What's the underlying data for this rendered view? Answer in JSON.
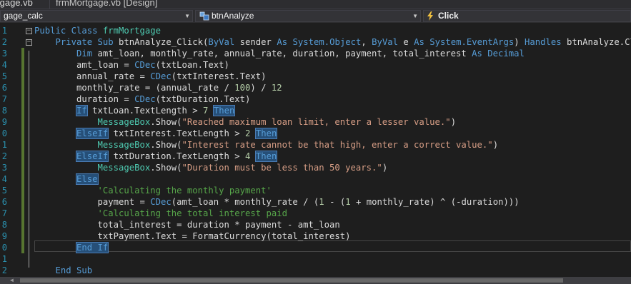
{
  "tabs": [
    {
      "label": "tgage.vb"
    },
    {
      "label": "frmMortgage.vb [Design]"
    }
  ],
  "navbar": {
    "project": "gage_calc",
    "object": "btnAnalyze",
    "event": "Click"
  },
  "line_numbers": [
    "1",
    "2",
    "3",
    "4",
    "5",
    "6",
    "7",
    "8",
    "9",
    "0",
    "1",
    "2",
    "3",
    "4",
    "5",
    "6",
    "7",
    "8",
    "9",
    "0",
    "1",
    "2"
  ],
  "code_lines": [
    [
      {
        "t": "Public Class ",
        "c": "kw"
      },
      {
        "t": "frmMortgage",
        "c": "ty"
      }
    ],
    [
      {
        "t": "    Private Sub ",
        "c": "kw"
      },
      {
        "t": "btnAnalyze_Click(",
        "c": ""
      },
      {
        "t": "ByVal",
        "c": "kw"
      },
      {
        "t": " sender ",
        "c": ""
      },
      {
        "t": "As System.Object",
        "c": "kw"
      },
      {
        "t": ", ",
        "c": ""
      },
      {
        "t": "ByVal",
        "c": "kw"
      },
      {
        "t": " e ",
        "c": ""
      },
      {
        "t": "As System.EventArgs",
        "c": "kw"
      },
      {
        "t": ") ",
        "c": ""
      },
      {
        "t": "Handles",
        "c": "kw"
      },
      {
        "t": " btnAnalyze.Click",
        "c": ""
      }
    ],
    [
      {
        "t": "        ",
        "c": ""
      },
      {
        "t": "Dim",
        "c": "kw"
      },
      {
        "t": " amt_loan, monthly_rate, annual_rate, duration, payment, total_interest ",
        "c": ""
      },
      {
        "t": "As Decimal",
        "c": "kw"
      }
    ],
    [
      {
        "t": "        amt_loan = ",
        "c": ""
      },
      {
        "t": "CDec",
        "c": "kw"
      },
      {
        "t": "(txtLoan.Text)",
        "c": ""
      }
    ],
    [
      {
        "t": "        annual_rate = ",
        "c": ""
      },
      {
        "t": "CDec",
        "c": "kw"
      },
      {
        "t": "(txtInterest.Text)",
        "c": ""
      }
    ],
    [
      {
        "t": "        monthly_rate = (annual_rate / ",
        "c": ""
      },
      {
        "t": "100",
        "c": "nm"
      },
      {
        "t": ") / ",
        "c": ""
      },
      {
        "t": "12",
        "c": "nm"
      }
    ],
    [
      {
        "t": "        duration = ",
        "c": ""
      },
      {
        "t": "CDec",
        "c": "kw"
      },
      {
        "t": "(txtDuration.Text)",
        "c": ""
      }
    ],
    [
      {
        "t": "        ",
        "c": ""
      },
      {
        "t": "If",
        "c": "hl"
      },
      {
        "t": " txtLoan.TextLength > ",
        "c": ""
      },
      {
        "t": "7",
        "c": "nm"
      },
      {
        "t": " ",
        "c": ""
      },
      {
        "t": "Then",
        "c": "hl"
      }
    ],
    [
      {
        "t": "            ",
        "c": ""
      },
      {
        "t": "MessageBox",
        "c": "ty"
      },
      {
        "t": ".Show(",
        "c": ""
      },
      {
        "t": "\"Reached maximum loan limit, enter a lesser value.\"",
        "c": "st"
      },
      {
        "t": ")",
        "c": ""
      }
    ],
    [
      {
        "t": "        ",
        "c": ""
      },
      {
        "t": "ElseIf",
        "c": "hl"
      },
      {
        "t": " txtInterest.TextLength > ",
        "c": ""
      },
      {
        "t": "2",
        "c": "nm"
      },
      {
        "t": " ",
        "c": ""
      },
      {
        "t": "Then",
        "c": "hl"
      }
    ],
    [
      {
        "t": "            ",
        "c": ""
      },
      {
        "t": "MessageBox",
        "c": "ty"
      },
      {
        "t": ".Show(",
        "c": ""
      },
      {
        "t": "\"Interest rate cannot be that high, enter a correct value.\"",
        "c": "st"
      },
      {
        "t": ")",
        "c": ""
      }
    ],
    [
      {
        "t": "        ",
        "c": ""
      },
      {
        "t": "ElseIf",
        "c": "hl"
      },
      {
        "t": " txtDuration.TextLength > ",
        "c": ""
      },
      {
        "t": "4",
        "c": "nm"
      },
      {
        "t": " ",
        "c": ""
      },
      {
        "t": "Then",
        "c": "hl"
      }
    ],
    [
      {
        "t": "            ",
        "c": ""
      },
      {
        "t": "MessageBox",
        "c": "ty"
      },
      {
        "t": ".Show(",
        "c": ""
      },
      {
        "t": "\"Duration must be less than 50 years.\"",
        "c": "st"
      },
      {
        "t": ")",
        "c": ""
      }
    ],
    [
      {
        "t": "        ",
        "c": ""
      },
      {
        "t": "Else",
        "c": "hl"
      }
    ],
    [
      {
        "t": "            ",
        "c": ""
      },
      {
        "t": "'Calculating the monthly payment'",
        "c": "cm"
      }
    ],
    [
      {
        "t": "            payment = ",
        "c": ""
      },
      {
        "t": "CDec",
        "c": "kw"
      },
      {
        "t": "(amt_loan * monthly_rate / (",
        "c": ""
      },
      {
        "t": "1",
        "c": "nm"
      },
      {
        "t": " - (",
        "c": ""
      },
      {
        "t": "1",
        "c": "nm"
      },
      {
        "t": " + monthly_rate) ^ (-duration)))",
        "c": ""
      }
    ],
    [
      {
        "t": "            ",
        "c": ""
      },
      {
        "t": "'Calculating the total interest paid",
        "c": "cm"
      }
    ],
    [
      {
        "t": "            total_interest = duration * payment - amt_loan",
        "c": ""
      }
    ],
    [
      {
        "t": "            txtPayment.Text = FormatCurrency(total_interest)",
        "c": ""
      }
    ],
    [
      {
        "t": "        ",
        "c": ""
      },
      {
        "t": "End If",
        "c": "hl"
      }
    ],
    [],
    [
      {
        "t": "    End Sub",
        "c": "kw"
      }
    ]
  ],
  "colors": {
    "keyword": "#569cd6",
    "type": "#4ec9b0",
    "string": "#d69d85",
    "comment": "#57a64a",
    "number": "#b5cea8",
    "line_number": "#2b91af",
    "change_marker": "#577430"
  }
}
